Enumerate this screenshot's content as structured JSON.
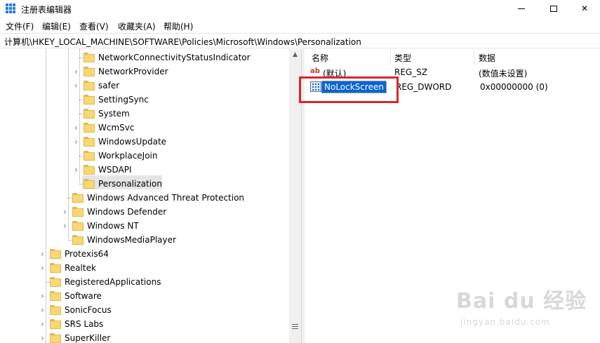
{
  "window": {
    "title": "注册表编辑器",
    "controls": {
      "minimize": "",
      "maximize": "",
      "close": "✕"
    }
  },
  "menu": {
    "items": [
      "文件(F)",
      "编辑(E)",
      "查看(V)",
      "收藏夹(A)",
      "帮助(H)"
    ]
  },
  "address": {
    "path": "计算机\\HKEY_LOCAL_MACHINE\\SOFTWARE\\Policies\\Microsoft\\Windows\\Personalization"
  },
  "tree": {
    "items": [
      {
        "label": "NetworkConnectivityStatusIndicator",
        "level": 3,
        "expandable": false
      },
      {
        "label": "NetworkProvider",
        "level": 3,
        "expandable": true
      },
      {
        "label": "safer",
        "level": 3,
        "expandable": true
      },
      {
        "label": "SettingSync",
        "level": 3,
        "expandable": false
      },
      {
        "label": "System",
        "level": 3,
        "expandable": false
      },
      {
        "label": "WcmSvc",
        "level": 3,
        "expandable": true
      },
      {
        "label": "WindowsUpdate",
        "level": 3,
        "expandable": true
      },
      {
        "label": "WorkplaceJoin",
        "level": 3,
        "expandable": false
      },
      {
        "label": "WSDAPI",
        "level": 3,
        "expandable": true
      },
      {
        "label": "Personalization",
        "level": 3,
        "expandable": false,
        "selected": true
      },
      {
        "label": "Windows Advanced Threat Protection",
        "level": 2,
        "expandable": false
      },
      {
        "label": "Windows Defender",
        "level": 2,
        "expandable": true
      },
      {
        "label": "Windows NT",
        "level": 2,
        "expandable": true
      },
      {
        "label": "WindowsMediaPlayer",
        "level": 2,
        "expandable": false
      },
      {
        "label": "Protexis64",
        "level": 1,
        "expandable": true
      },
      {
        "label": "Realtek",
        "level": 1,
        "expandable": true
      },
      {
        "label": "RegisteredApplications",
        "level": 1,
        "expandable": false
      },
      {
        "label": "Software",
        "level": 1,
        "expandable": true
      },
      {
        "label": "SonicFocus",
        "level": 1,
        "expandable": true
      },
      {
        "label": "SRS Labs",
        "level": 1,
        "expandable": true
      },
      {
        "label": "SuperKiller",
        "level": 1,
        "expandable": true
      }
    ]
  },
  "list": {
    "headers": {
      "name": "名称",
      "type": "类型",
      "data": "数据"
    },
    "rows": [
      {
        "name": "(默认)",
        "type": "REG_SZ",
        "data": "(数值未设置)",
        "icon": "string-value-icon"
      },
      {
        "name": "NoLockScreen",
        "type": "REG_DWORD",
        "data": "0x00000000 (0)",
        "icon": "binary-value-icon",
        "selected": true
      }
    ]
  },
  "watermark": {
    "logo": "Bai du 经验",
    "url": "jingyan.baidu.com"
  },
  "colors": {
    "selection": "#0a64d2",
    "highlight_box": "#d9262e",
    "folder": "#f8d775"
  }
}
